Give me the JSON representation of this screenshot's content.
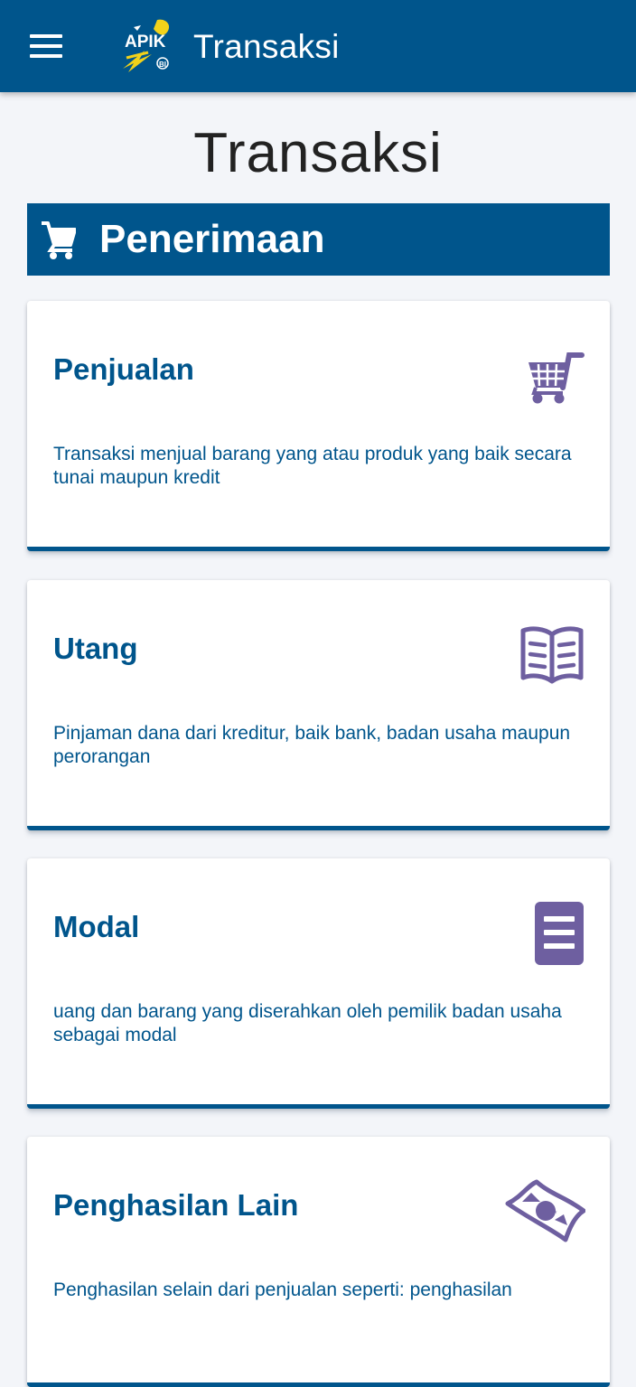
{
  "appbar": {
    "title": "Transaksi",
    "menu_icon": "hamburger-menu-icon",
    "logo_text": "APIK",
    "logo_sub": "BI"
  },
  "page": {
    "title": "Transaksi"
  },
  "section": {
    "title": "Penerimaan",
    "icon": "cart-icon"
  },
  "cards": [
    {
      "title": "Penjualan",
      "description": "Transaksi menjual barang yang atau produk yang baik secara tunai maupun kredit",
      "icon": "shopping-cart-icon"
    },
    {
      "title": "Utang",
      "description": "Pinjaman dana dari kreditur, baik bank, badan usaha maupun perorangan",
      "icon": "open-book-icon"
    },
    {
      "title": "Modal",
      "description": "uang dan barang yang diserahkan oleh pemilik badan usaha sebagai modal",
      "icon": "document-icon"
    },
    {
      "title": "Penghasilan Lain",
      "description": "Penghasilan selain dari penjualan seperti: penghasilan",
      "icon": "money-bill-icon"
    }
  ],
  "colors": {
    "primary": "#00558c",
    "background": "#f3f5f9",
    "icon_purple": "#6e5fa0",
    "logo_yellow": "#f2d21a"
  }
}
